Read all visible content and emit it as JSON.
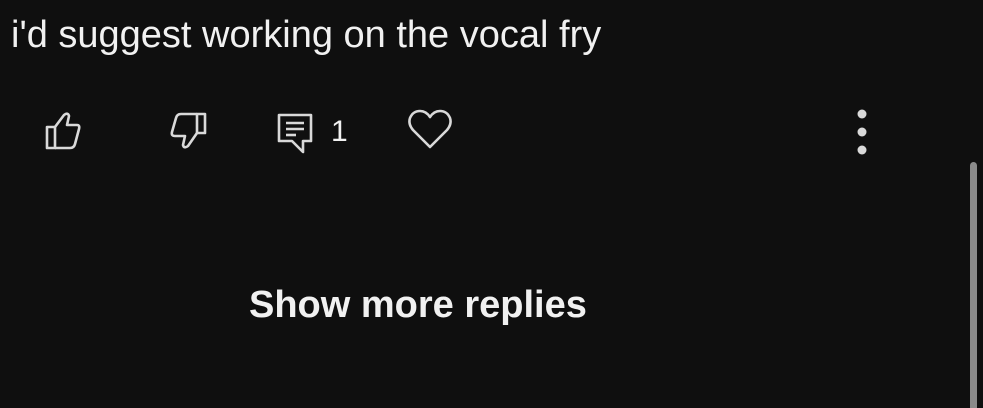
{
  "comment": {
    "text": "i'd suggest working on the vocal fry"
  },
  "actions": {
    "reply_count": "1",
    "like_icon": "thumbs-up-icon",
    "dislike_icon": "thumbs-down-icon",
    "reply_icon": "comment-reply-icon",
    "heart_icon": "heart-icon",
    "more_icon": "more-vertical-icon"
  },
  "replies": {
    "show_more_label": "Show more replies"
  },
  "colors": {
    "background": "#0f0f0f",
    "text": "#f1f1f1",
    "icon": "#d9d9d9",
    "scrollbar": "#8a8a8a"
  }
}
